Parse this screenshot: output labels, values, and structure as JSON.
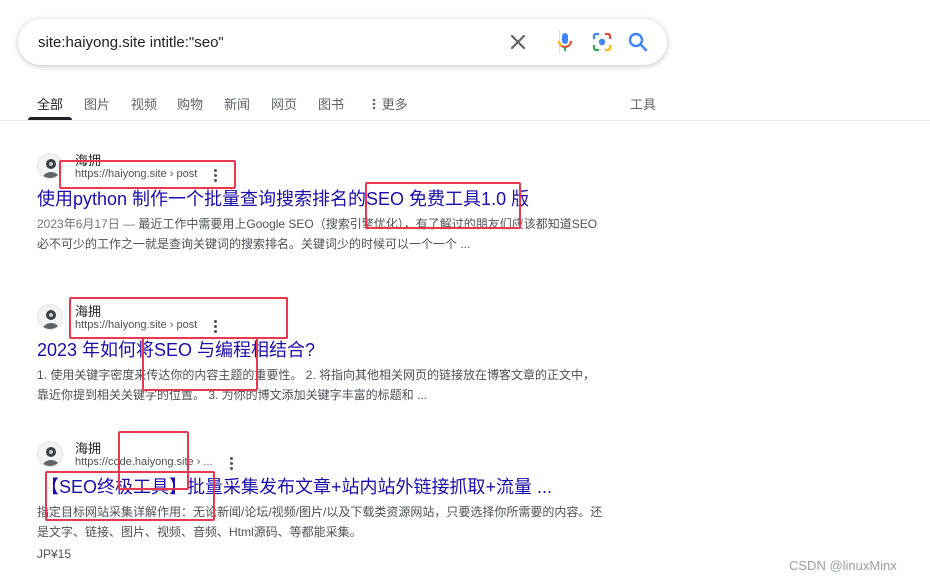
{
  "search": {
    "query": "site:haiyong.site intitle:\"seo\"",
    "clear_icon": "close-icon",
    "voice_icon": "microphone-icon",
    "lens_icon": "camera-lens-icon",
    "search_icon": "search-icon"
  },
  "tabs": [
    {
      "label": "全部",
      "active": true
    },
    {
      "label": "图片"
    },
    {
      "label": "视频"
    },
    {
      "label": "购物"
    },
    {
      "label": "新闻"
    },
    {
      "label": "网页"
    },
    {
      "label": "图书"
    },
    {
      "label": "更多"
    }
  ],
  "tools_label": "工具",
  "results": [
    {
      "site_name": "海拥",
      "url": "https://haiyong.site › post",
      "title": "使用python 制作一个批量查询搜索排名的SEO 免费工具1.0 版",
      "date": "2023年6月17日 — ",
      "snippet": "最近工作中需要用上Google SEO（搜索引擎优化），有了解过的朋友们应该都知道SEO 必不可少的工作之一就是查询关键词的搜索排名。关键词少的时候可以一个一个 ..."
    },
    {
      "site_name": "海拥",
      "url": "https://haiyong.site › post",
      "title": "2023 年如何将SEO 与编程相结合?",
      "snippet": "1. 使用关键字密度来传达你的内容主题的重要性。 2. 将指向其他相关网页的链接放在博客文章的正文中，靠近你提到相关关键字的位置。 3. 为你的博文添加关键字丰富的标题和 ..."
    },
    {
      "site_name": "海拥",
      "url": "https://code.haiyong.site › ...",
      "title": "【SEO终极工具】批量采集发布文章+站内站外链接抓取+流量 ...",
      "snippet": "指定目标网站采集详解作用：无论新闻/论坛/视频/图片/以及下载类资源网站，只要选择你所需要的内容。还是文字、链接、图片、视频、音频、Html源码、等都能采集。",
      "price": "JP¥15"
    }
  ],
  "watermark": "CSDN @linuxMinx",
  "colors": {
    "link": "#1a0dab",
    "annotation": "#e8384f",
    "google_blue": "#4285f4"
  }
}
